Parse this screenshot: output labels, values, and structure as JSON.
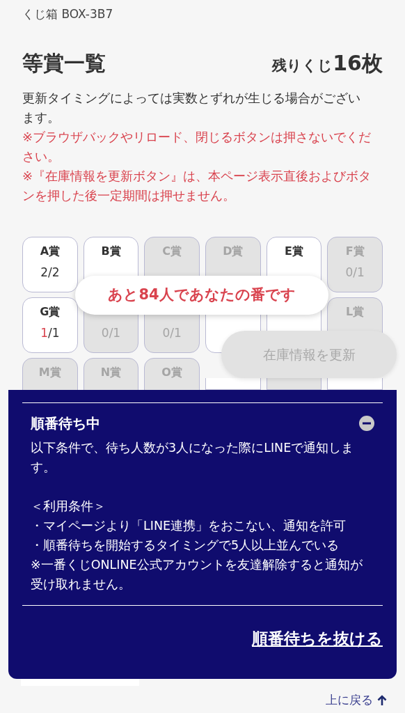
{
  "breadcrumb": "くじ箱 BOX-3B7",
  "title": "等賞一覧",
  "remaining": {
    "label": "残りくじ",
    "value": "16枚"
  },
  "notes": [
    {
      "kind": "info",
      "text": "更新タイミングによっては実数とずれが生じる場合がございます。"
    },
    {
      "kind": "warning",
      "text": "※ブラウザバックやリロード、閉じるボタンは押さないでください。"
    },
    {
      "kind": "warning",
      "text": "※『在庫情報を更新ボタン』は、本ページ表示直後およびボタンを押した後一定期間は押せません。"
    }
  ],
  "prizes": [
    {
      "label": "A賞",
      "remaining": "2",
      "rest": "/2",
      "low": false,
      "sold_out": false
    },
    {
      "label": "B賞",
      "sold_out": false
    },
    {
      "label": "C賞",
      "sold_out": true
    },
    {
      "label": "D賞",
      "sold_out": true
    },
    {
      "label": "E賞",
      "sold_out": false
    },
    {
      "label": "F賞",
      "remaining": "0",
      "rest": "/1",
      "low": false,
      "sold_out": true
    },
    {
      "label": "G賞",
      "remaining": "1",
      "rest": "/1",
      "low": true,
      "sold_out": false
    },
    {
      "remaining": "0",
      "rest": "/1",
      "low": false,
      "sold_out": true
    },
    {
      "remaining": "0",
      "rest": "/1",
      "low": false,
      "sold_out": true
    },
    {
      "sold_out": false
    },
    {
      "sold_out": false
    },
    {
      "label": "L賞",
      "sold_out": true
    },
    {
      "label": "M賞",
      "sold_out": true
    },
    {
      "label": "N賞",
      "sold_out": true
    },
    {
      "label": "O賞",
      "sold_out": true
    },
    {
      "sold_out": false
    },
    {
      "sold_out": true
    },
    {
      "sold_out": false
    }
  ],
  "queue_toast": "あと84人であなたの番です",
  "refresh_button": {
    "label": "在庫情報を更新",
    "disabled": true
  },
  "queue_panel": {
    "title": "順番待ち中",
    "expanded": true,
    "paragraphs": [
      {
        "text": "以下条件で、待ち人数が3人になった際にLINEで通知します。",
        "gap_before": false
      },
      {
        "text": "＜利用条件＞",
        "gap_before": true
      },
      {
        "text": "・マイページより「LINE連携」をおこない、通知を許可",
        "gap_before": false
      },
      {
        "text": "・順番待ちを開始するタイミングで5人以上並んでいる",
        "gap_before": false
      },
      {
        "text": "※一番くじONLINE公式アカウントを友達解除すると通知が受け取れません。",
        "gap_before": false
      }
    ],
    "leave_link": "順番待ちを抜ける"
  },
  "back_to_top": "上に戻る"
}
